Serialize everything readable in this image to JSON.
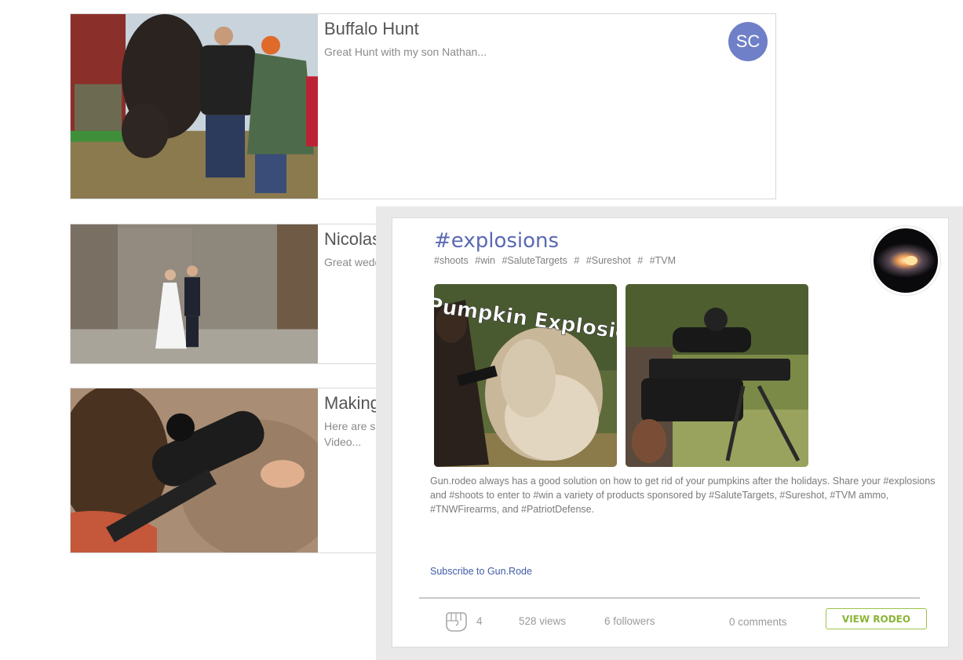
{
  "feed": [
    {
      "title": "Buffalo Hunt",
      "subtitle": "Great Hunt with my son Nathan...",
      "avatar_initials": "SC",
      "avatar_color": "#6f7fc8"
    },
    {
      "title": "Nicolas",
      "subtitle": "Great wedd"
    },
    {
      "title": "Making",
      "subtitle": "Here are s\nVideo..."
    }
  ],
  "rodeo": {
    "title": "#explosions",
    "tags": [
      "#shoots",
      "#win",
      "#SaluteTargets",
      "#",
      "#Sureshot",
      "#",
      "#TVM"
    ],
    "media_caption": "Pumpkin Explosion!",
    "description": "Gun.rodeo always has a good solution on how to get rid of your pumpkins after the holidays. Share your #explosions and #shoots to enter to #win a variety of products sponsored by #SaluteTargets, #Sureshot, #TVM ammo, #TNWFirearms, and #PatriotDefense.",
    "subscribe_label": "Subscribe to Gun.Rode",
    "likes": "4",
    "views": "528 views",
    "followers": "6 followers",
    "comments": "0 comments",
    "view_button": "VIEW RODEO",
    "colors": {
      "title": "#5b69b3",
      "link": "#3f5ca8",
      "button": "#8ab436"
    }
  }
}
